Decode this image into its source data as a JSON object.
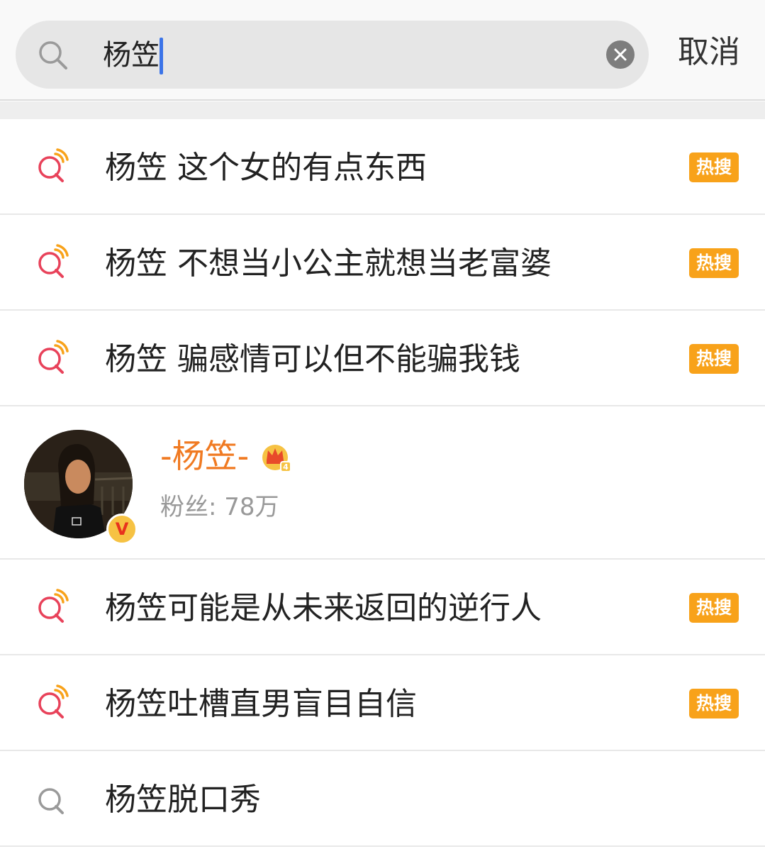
{
  "search": {
    "query": "杨笠",
    "cancel_label": "取消"
  },
  "results": [
    {
      "text": "杨笠 这个女的有点东西",
      "badge": "热搜",
      "icon": "hot-search-icon"
    },
    {
      "text": "杨笠 不想当小公主就想当老富婆",
      "badge": "热搜",
      "icon": "hot-search-icon"
    },
    {
      "text": "杨笠 骗感情可以但不能骗我钱",
      "badge": "热搜",
      "icon": "hot-search-icon"
    }
  ],
  "user": {
    "name": "-杨笠-",
    "fans": "粉丝: 78万",
    "verified_icon": "verified-v-icon",
    "member_icon": "crown-icon"
  },
  "results2": [
    {
      "text": "杨笠可能是从未来返回的逆行人",
      "badge": "热搜",
      "icon": "hot-search-icon"
    },
    {
      "text": "杨笠吐槽直男盲目自信",
      "badge": "热搜",
      "icon": "hot-search-icon"
    },
    {
      "text": "杨笠脱口秀",
      "icon": "search-icon"
    }
  ],
  "colors": {
    "accent_orange": "#f8a21a",
    "username_orange": "#f07a22",
    "hot_icon_red": "#e8425a",
    "caret_blue": "#3b74e8"
  }
}
